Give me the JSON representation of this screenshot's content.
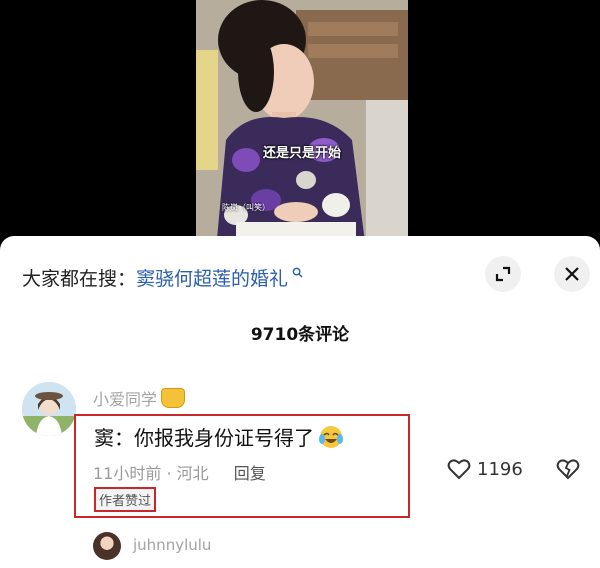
{
  "video": {
    "subtitle": "还是只是开始",
    "caption_name": "陈岚（叫笑）"
  },
  "search": {
    "prefix": "大家都在搜：",
    "keyword": "窦骁何超莲的婚礼",
    "icon": "search-icon"
  },
  "comment_count": "9710条评论",
  "comment": {
    "username": "小爱同学",
    "badge": "honey-jar-icon",
    "text": "窦：你报我身份证号得了",
    "emoji": "crying-laughing-emoji",
    "time_location": "11小时前 · 河北",
    "reply_label": "回复",
    "author_liked": "作者赞过",
    "likes": "1196"
  },
  "sub_reply": {
    "username": "juhnnylulu"
  },
  "colors": {
    "accent_blue": "#2a5fb0",
    "highlight_red": "#c8282a"
  }
}
